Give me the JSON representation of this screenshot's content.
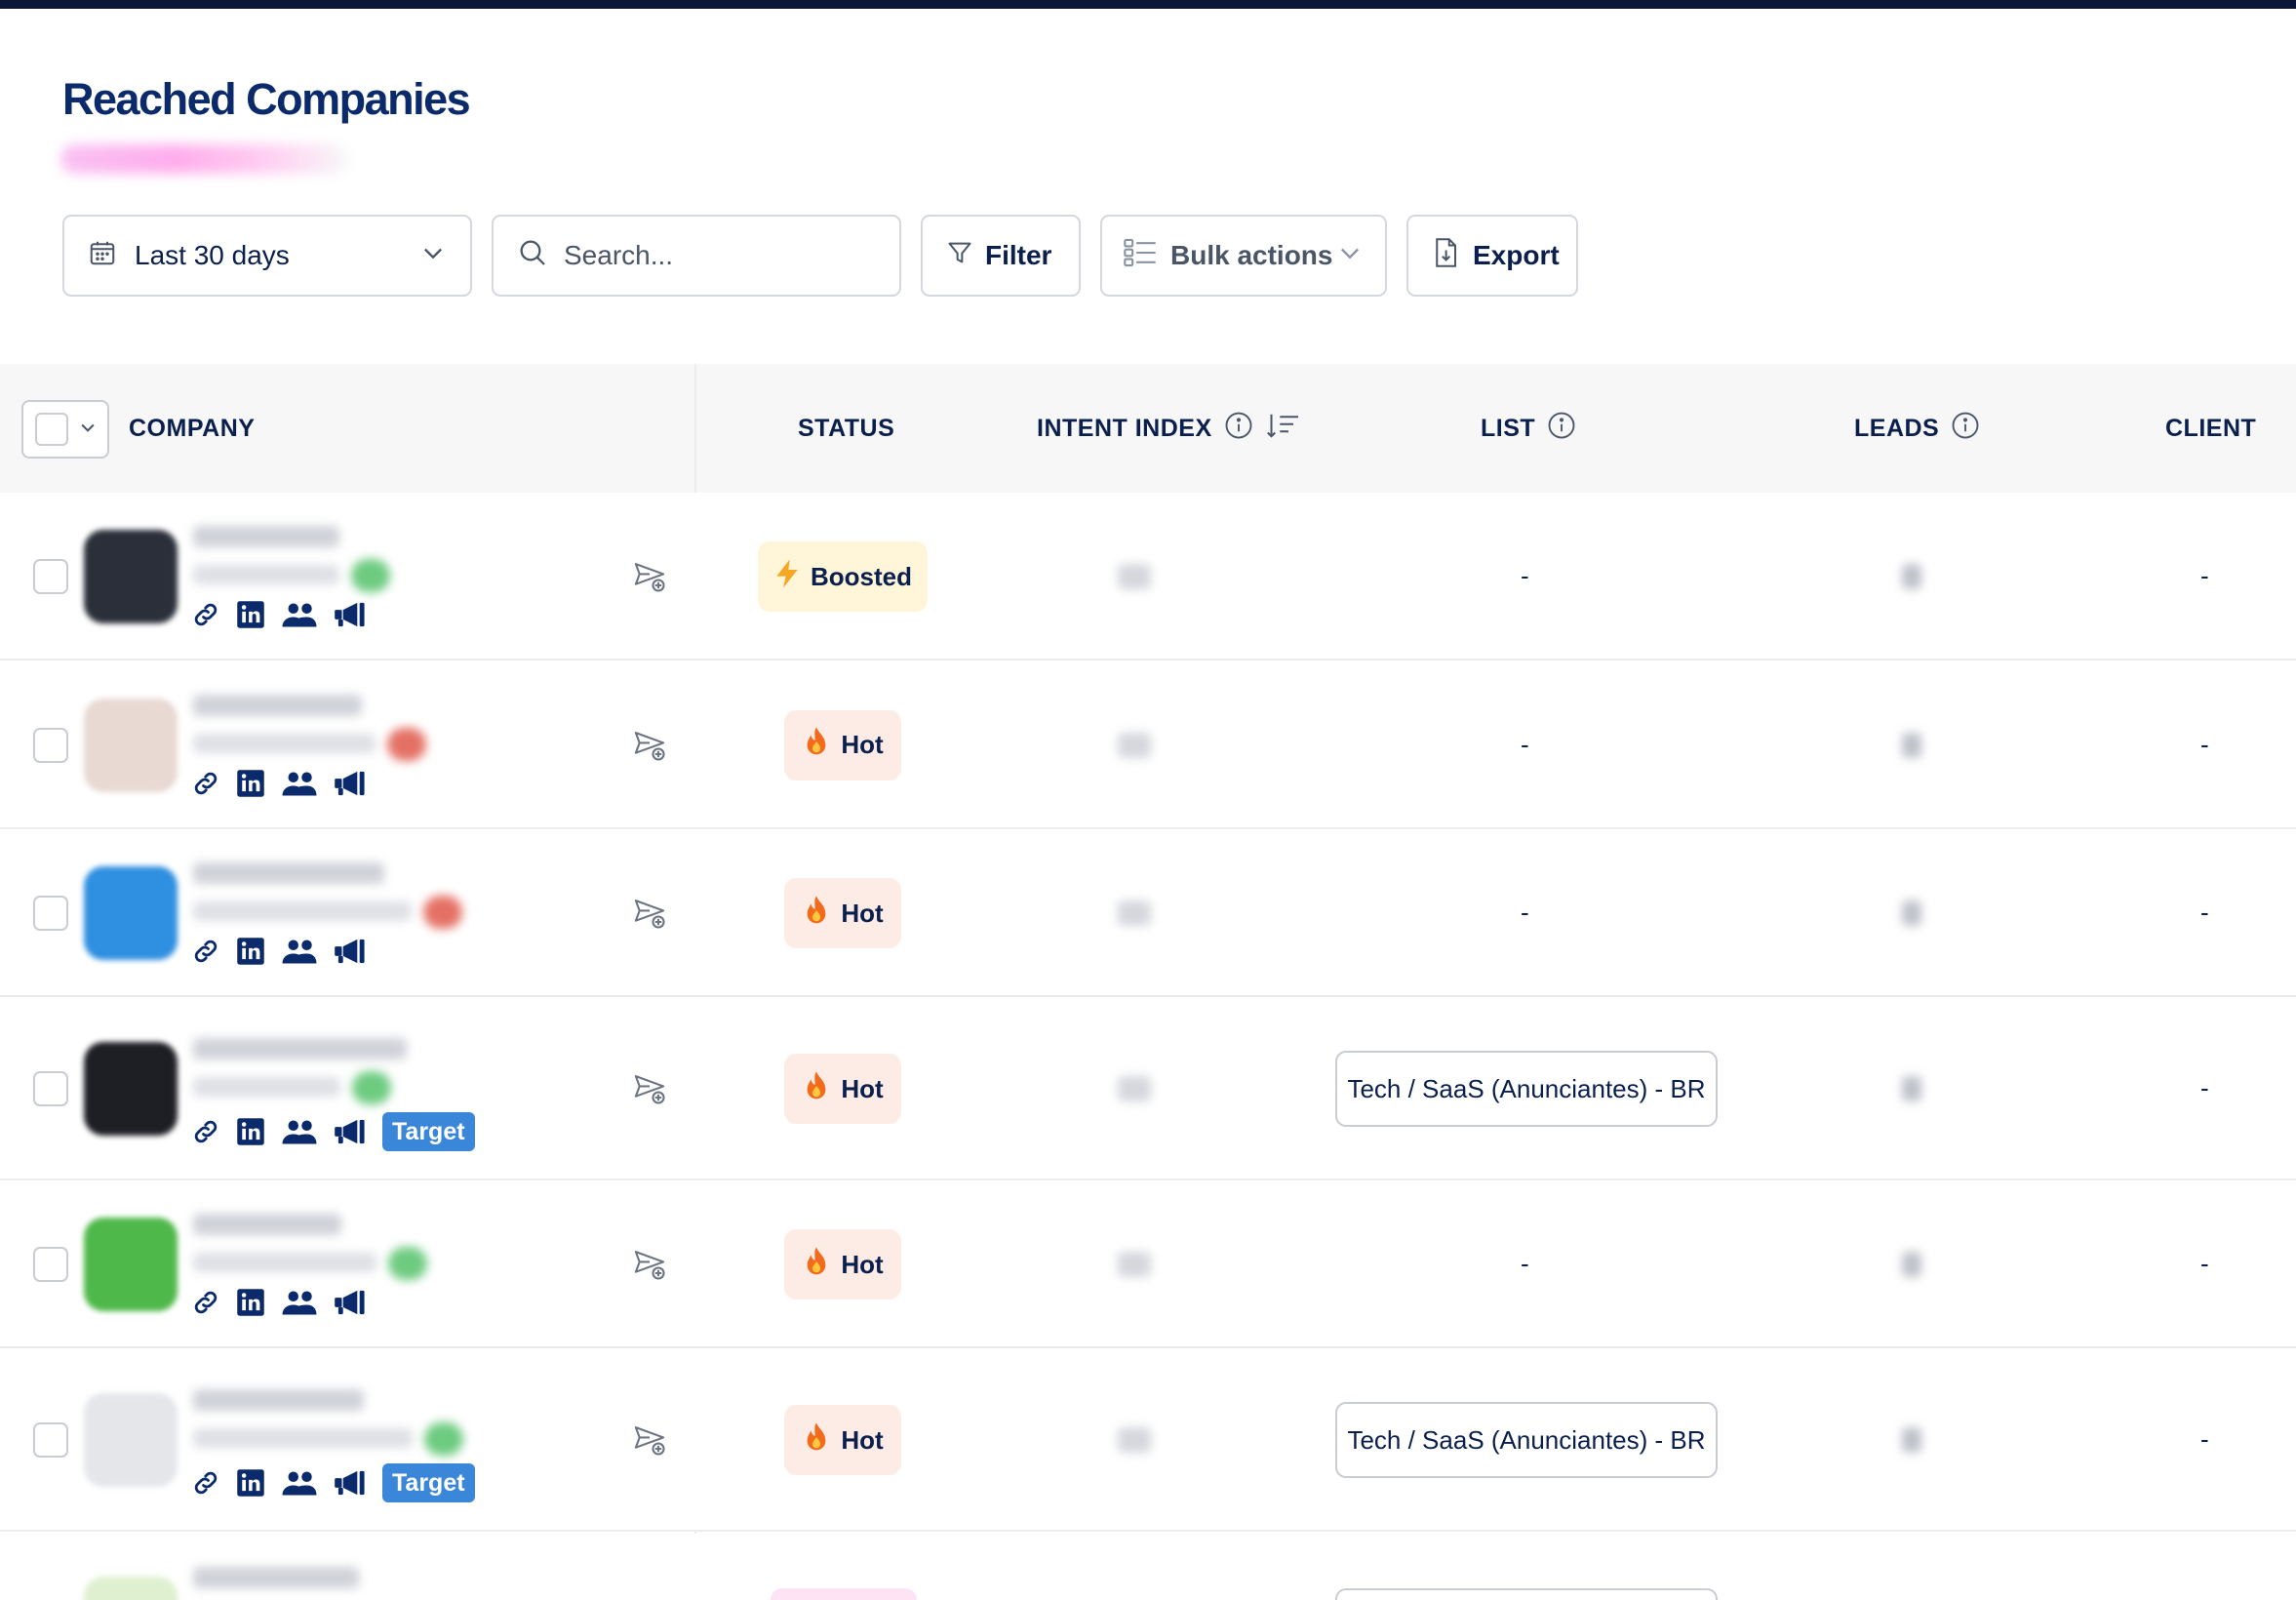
{
  "page": {
    "title": "Reached Companies"
  },
  "toolbar": {
    "date_range": "Last 30 days",
    "search_placeholder": "Search...",
    "filter_label": "Filter",
    "bulk_label": "Bulk actions",
    "export_label": "Export"
  },
  "table": {
    "headers": {
      "company": "COMPANY",
      "status": "STATUS",
      "intent": "INTENT INDEX",
      "list": "LIST",
      "leads": "LEADS",
      "client": "CLIENT"
    },
    "rows": [
      {
        "status": "Boosted",
        "status_icon": "lightning-icon",
        "list": "-",
        "client": "-",
        "target_badge": "",
        "logo_color": "#2b2f3a",
        "flag_color": "#54c26a"
      },
      {
        "status": "Hot",
        "status_icon": "fire-icon",
        "list": "-",
        "client": "-",
        "target_badge": "",
        "logo_color": "#e8d9d2",
        "flag_color": "#e0584a"
      },
      {
        "status": "Hot",
        "status_icon": "fire-icon",
        "list": "-",
        "client": "-",
        "target_badge": "",
        "logo_color": "#2f8fe0",
        "flag_color": "#e0584a"
      },
      {
        "status": "Hot",
        "status_icon": "fire-icon",
        "list": "Tech / SaaS (Anunciantes) - BR",
        "client": "-",
        "target_badge": "Target",
        "logo_color": "#1e1f24",
        "flag_color": "#54c26a"
      },
      {
        "status": "Hot",
        "status_icon": "fire-icon",
        "list": "-",
        "client": "-",
        "target_badge": "",
        "logo_color": "#4fb84a",
        "flag_color": "#54c26a"
      },
      {
        "status": "Hot",
        "status_icon": "fire-icon",
        "list": "Tech / SaaS (Anunciantes) - BR",
        "client": "-",
        "target_badge": "Target",
        "logo_color": "#e4e6ea",
        "flag_color": "#54c26a"
      }
    ]
  },
  "colors": {
    "brand_navy": "#0b2a6b",
    "boosted_bg": "#fff6d9",
    "hot_bg": "#fdece6",
    "target_badge": "#3a86d8"
  }
}
